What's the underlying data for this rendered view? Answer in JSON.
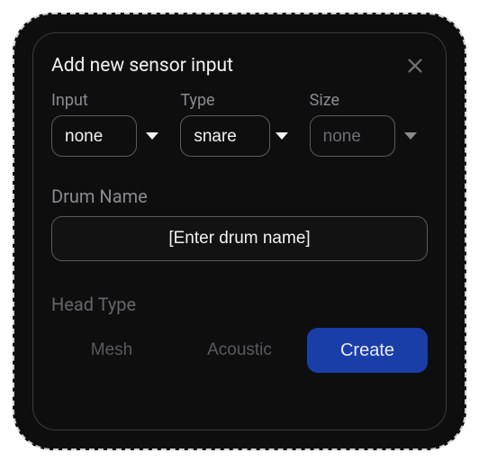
{
  "dialog": {
    "title": "Add new sensor input"
  },
  "fields": {
    "input": {
      "label": "Input",
      "value": "none"
    },
    "type": {
      "label": "Type",
      "value": "snare"
    },
    "size": {
      "label": "Size",
      "value": "none"
    }
  },
  "drum_name": {
    "label": "Drum Name",
    "placeholder": "[Enter drum name]",
    "value": ""
  },
  "head_type": {
    "label": "Head Type",
    "options": {
      "mesh": "Mesh",
      "acoustic": "Acoustic"
    }
  },
  "actions": {
    "create": "Create"
  }
}
